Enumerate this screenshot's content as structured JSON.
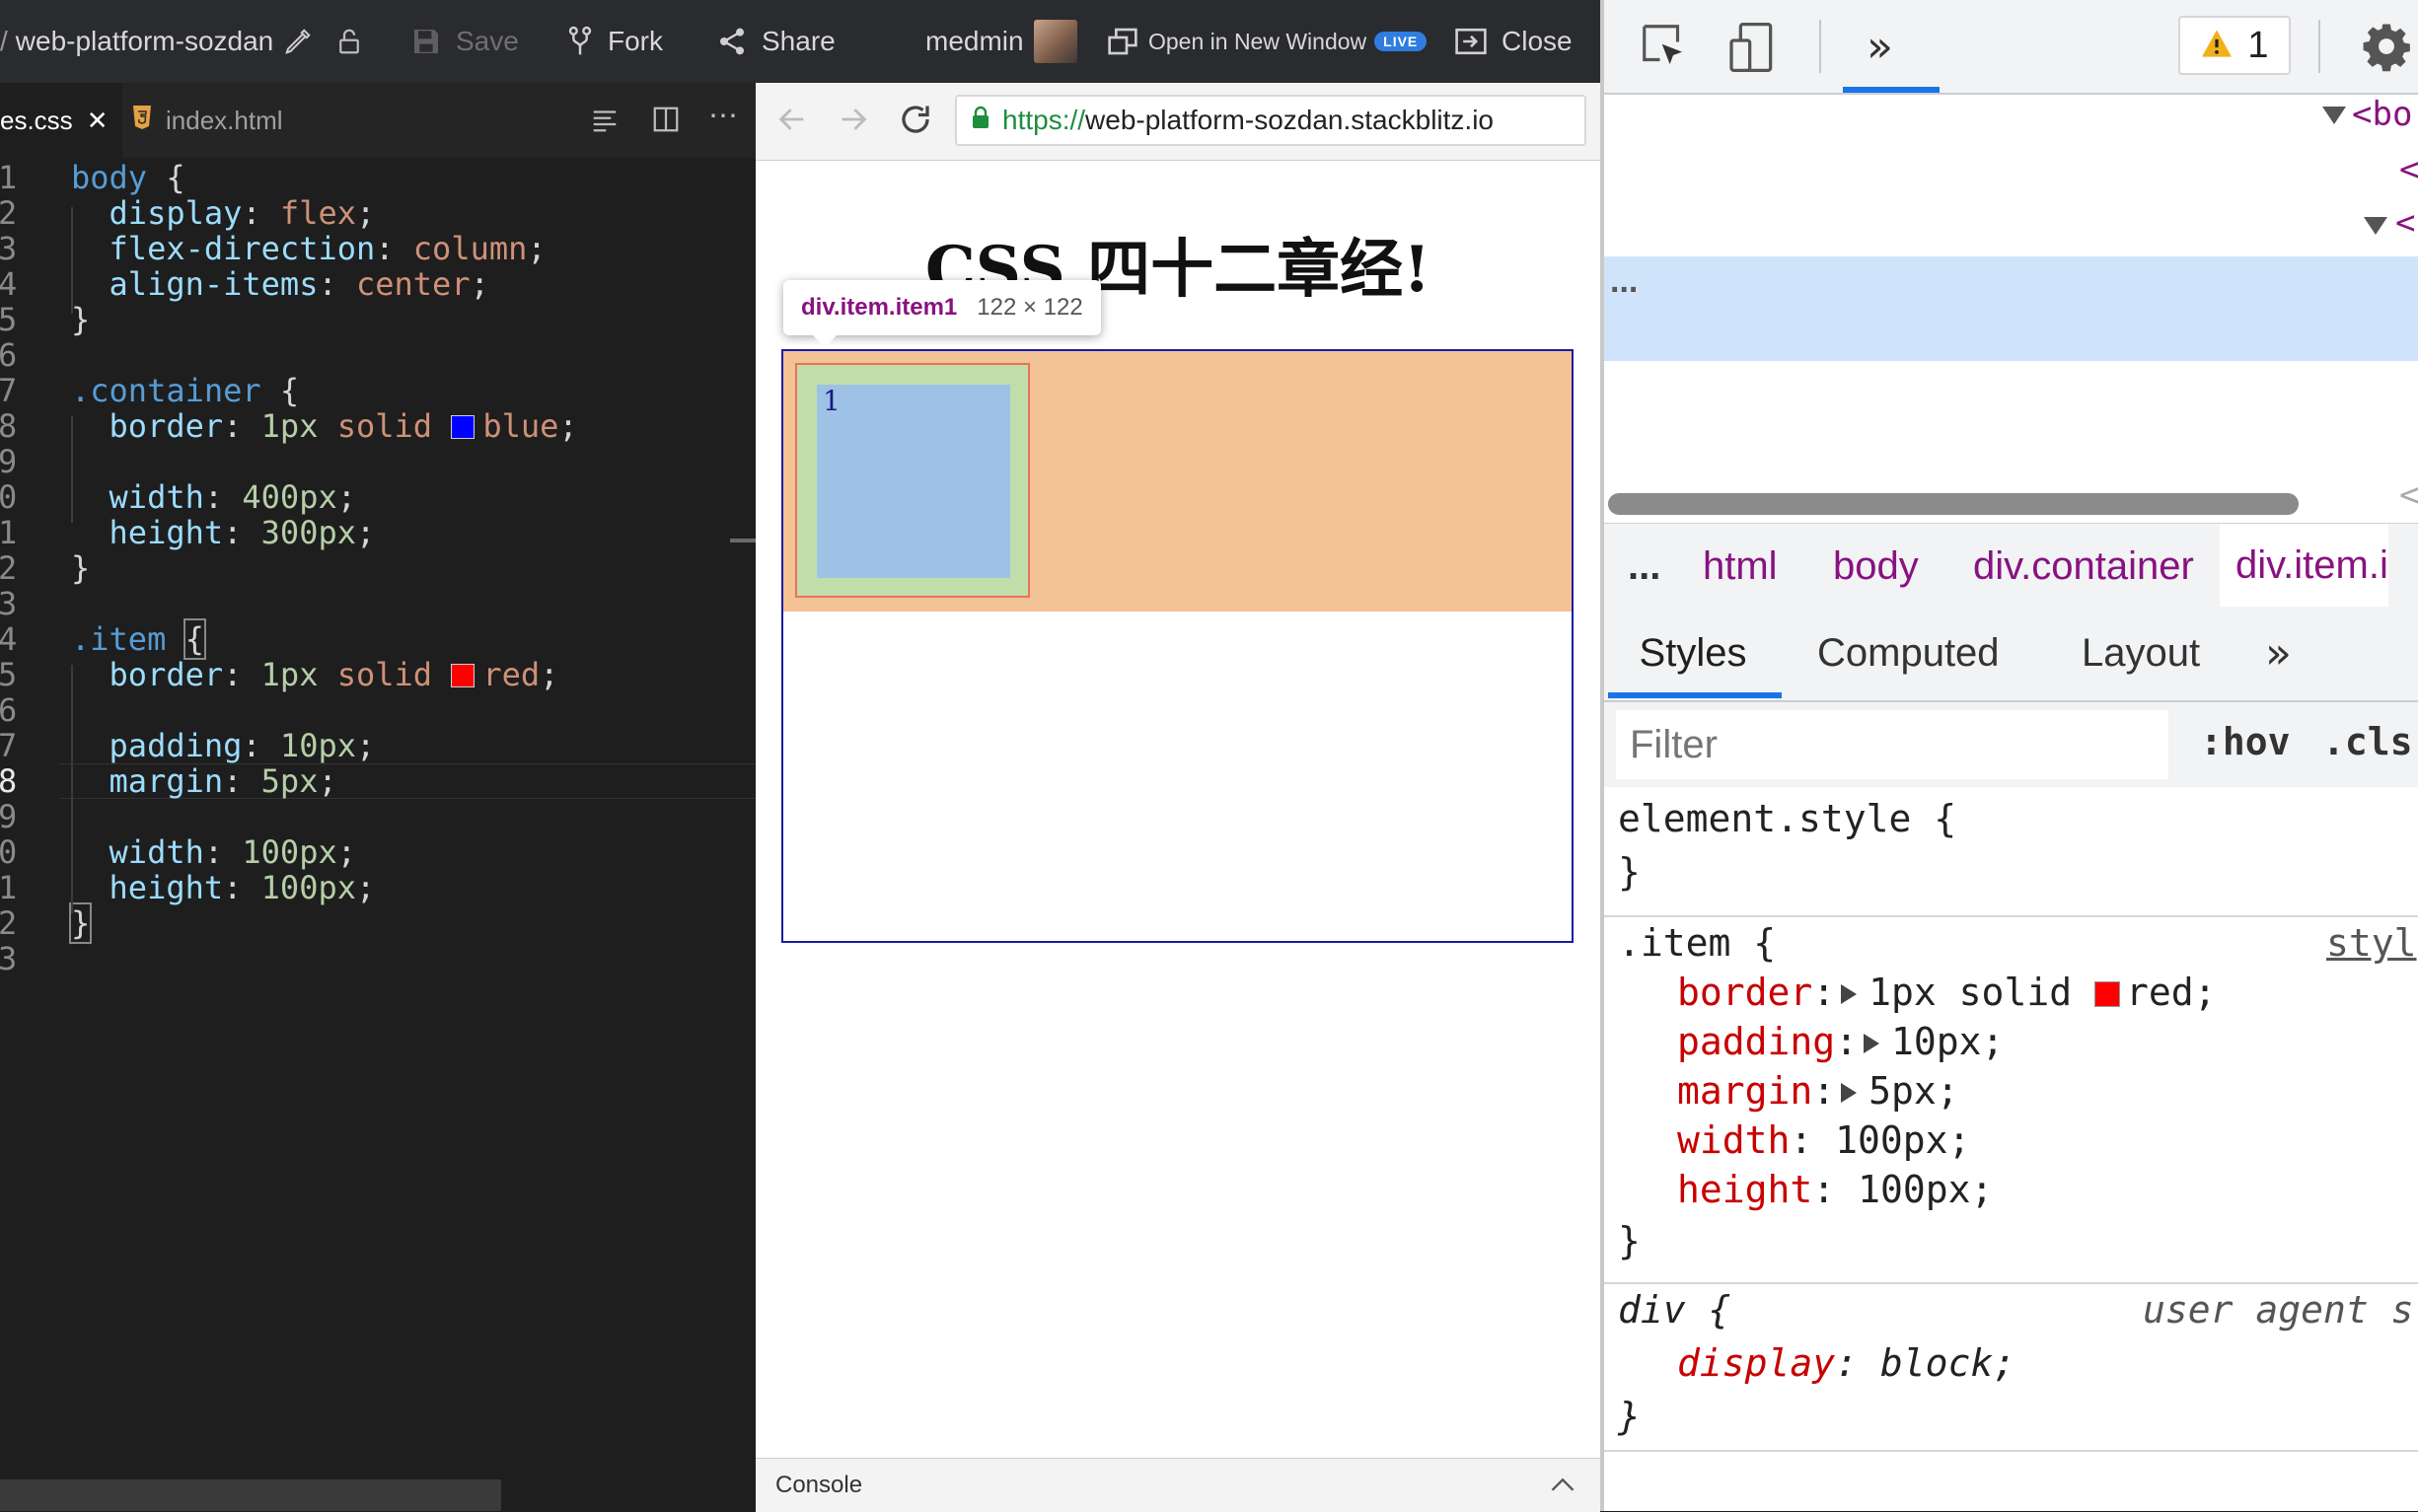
{
  "toolbar": {
    "breadcrumb_slash": "/",
    "project_name": "web-platform-sozdan",
    "save": "Save",
    "fork": "Fork",
    "share": "Share",
    "user": "medmin",
    "open_new_window": "Open in New Window",
    "live_badge": "LIVE",
    "close": "Close"
  },
  "editor": {
    "tabs": [
      {
        "label": "es.css",
        "active": true
      },
      {
        "label": "index.html",
        "active": false
      }
    ],
    "lines": [
      {
        "n": "1",
        "html": "<span class=\"sel\">body</span> {"
      },
      {
        "n": "2",
        "html": "  <span class=\"prop\">display</span>: <span class=\"val\">flex</span>;"
      },
      {
        "n": "3",
        "html": "  <span class=\"prop\">flex-direction</span>: <span class=\"val\">column</span>;"
      },
      {
        "n": "4",
        "html": "  <span class=\"prop\">align-items</span>: <span class=\"val\">center</span>;"
      },
      {
        "n": "5",
        "html": "}"
      },
      {
        "n": "6",
        "html": ""
      },
      {
        "n": "7",
        "html": "<span class=\"sel\">.container</span> {"
      },
      {
        "n": "8",
        "html": "  <span class=\"prop\">border</span>: <span class=\"num\">1px</span> <span class=\"val\">solid</span> <span class=\"swatch\" style=\"background:#0000ff\"></span><span class=\"val\">blue</span>;"
      },
      {
        "n": "9",
        "html": ""
      },
      {
        "n": "0",
        "html": "  <span class=\"prop\">width</span>: <span class=\"num\">400px</span>;"
      },
      {
        "n": "1",
        "html": "  <span class=\"prop\">height</span>: <span class=\"num\">300px</span>;"
      },
      {
        "n": "2",
        "html": "}"
      },
      {
        "n": "3",
        "html": ""
      },
      {
        "n": "4",
        "html": "<span class=\"sel\">.item</span> <span style=\"outline:2px solid #888\">{</span>"
      },
      {
        "n": "5",
        "html": "  <span class=\"prop\">border</span>: <span class=\"num\">1px</span> <span class=\"val\">solid</span> <span class=\"swatch\" style=\"background:#ff0000\"></span><span class=\"val\">red</span>;"
      },
      {
        "n": "6",
        "html": ""
      },
      {
        "n": "7",
        "html": "  <span class=\"prop\">padding</span>: <span class=\"num\">10px</span>;"
      },
      {
        "n": "8",
        "html": "  <span class=\"prop\">margin</span>: <span class=\"num\">5px</span>;"
      },
      {
        "n": "9",
        "html": ""
      },
      {
        "n": "0",
        "html": "  <span class=\"prop\">width</span>: <span class=\"num\">100px</span>;"
      },
      {
        "n": "1",
        "html": "  <span class=\"prop\">height</span>: <span class=\"num\">100px</span>;"
      },
      {
        "n": "2",
        "html": "<span style=\"outline:2px solid #888\">}</span>"
      },
      {
        "n": "3",
        "html": ""
      }
    ],
    "active_line_index": 17
  },
  "preview": {
    "url_scheme": "https://",
    "url_host": "web-platform-sozdan.stackblitz.io",
    "heading": "CSS 四十二章经!",
    "tooltip_selector": "div.item.item1",
    "tooltip_size": "122 × 122",
    "item_number": "1",
    "console_label": "Console"
  },
  "devtools": {
    "warning_count": "1",
    "dom_lines": [
      "<bo",
      "<",
      "<"
    ],
    "dom_ellipsis": "...",
    "breadcrumbs": [
      "...",
      "html",
      "body",
      "div.container",
      "div.item.i"
    ],
    "panel_tabs": [
      "Styles",
      "Computed",
      "Layout"
    ],
    "filter_placeholder": "Filter",
    "hov": ":hov",
    "cls": ".cls",
    "element_style_selector": "element.style {",
    "close_brace": "}",
    "item_selector": ".item {",
    "item_source": "styl",
    "item_decls": [
      {
        "prop": "border",
        "value": "1px solid",
        "color_name": "red",
        "has_tri": true,
        "swatch": "#ff0000"
      },
      {
        "prop": "padding",
        "value": "10px;",
        "has_tri": true
      },
      {
        "prop": "margin",
        "value": "5px;",
        "has_tri": true
      },
      {
        "prop": "width",
        "value": "100px;",
        "has_tri": false
      },
      {
        "prop": "height",
        "value": "100px;",
        "has_tri": false
      }
    ],
    "div_selector": "div {",
    "div_source": "user agent s",
    "div_decl_prop": "display",
    "div_decl_value": "block;"
  },
  "colors": {
    "accent_blue": "#1a73e8",
    "dom_tag": "#881280",
    "css_prop": "#c80000",
    "margin_highlight": "#f3c295",
    "padding_highlight": "#c0deaa",
    "content_highlight": "#9ec1e6"
  }
}
